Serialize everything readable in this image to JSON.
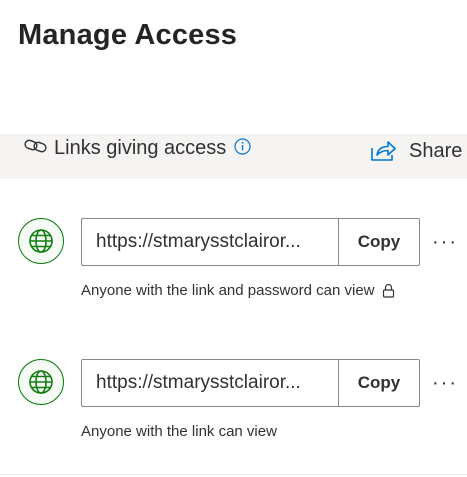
{
  "page": {
    "title": "Manage Access"
  },
  "links_section": {
    "label": "Links giving access",
    "share_label": "Share"
  },
  "links": [
    {
      "url": "https://stmarysstclairor...",
      "copy_label": "Copy",
      "more_label": "···",
      "description": "Anyone with the link and password can view",
      "has_lock": true
    },
    {
      "url": "https://stmarysstclairor...",
      "copy_label": "Copy",
      "more_label": "···",
      "description": "Anyone with the link can view",
      "has_lock": false
    }
  ],
  "icons": {
    "link": "link-icon",
    "info": "info-icon",
    "share": "share-icon",
    "globe": "globe-icon",
    "lock": "lock-icon"
  },
  "colors": {
    "globe_green": "#107c10",
    "accent_blue": "#0078d4",
    "header_bg": "#f5f4f3"
  }
}
